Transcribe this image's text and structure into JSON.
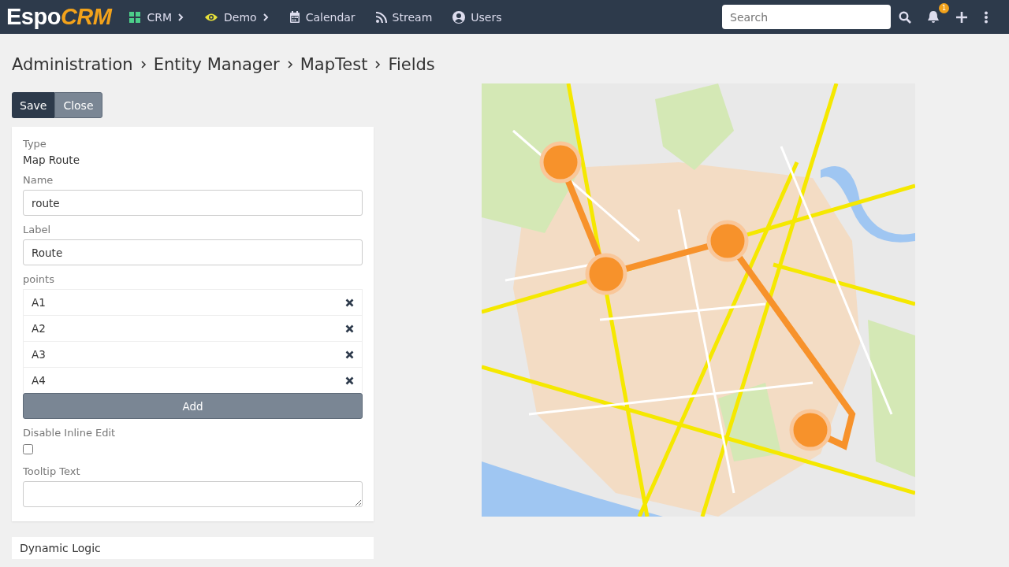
{
  "navbar": {
    "logo": {
      "first": "Espo",
      "second": "CRM"
    },
    "items": [
      {
        "kind": "grid",
        "label": "CRM",
        "dropdown": true
      },
      {
        "kind": "eye",
        "label": "Demo",
        "dropdown": true
      },
      {
        "kind": "calendar",
        "label": "Calendar",
        "dropdown": false
      },
      {
        "kind": "feed",
        "label": "Stream",
        "dropdown": false
      },
      {
        "kind": "user",
        "label": "Users",
        "dropdown": false
      }
    ],
    "search": {
      "placeholder": "Search"
    },
    "notifications": {
      "count": "1"
    }
  },
  "breadcrumb": [
    "Administration",
    "Entity Manager",
    "MapTest",
    "Fields"
  ],
  "actions": [
    {
      "label": "Save",
      "kind": "primary"
    },
    {
      "label": "Close",
      "kind": "secondary"
    }
  ],
  "form": [
    {
      "kind": "static",
      "label": "Type",
      "value": "Map Route"
    },
    {
      "kind": "input",
      "label": "Name",
      "value": "route"
    },
    {
      "kind": "input",
      "label": "Label",
      "value": "Route"
    },
    {
      "kind": "array",
      "label": "points",
      "items": [
        "A1",
        "A2",
        "A3",
        "A4"
      ],
      "button": "Add"
    },
    {
      "kind": "checkbox",
      "label": "Disable Inline Edit",
      "checked": false
    },
    {
      "kind": "textarea",
      "label": "Tooltip Text"
    }
  ],
  "panels": [
    {
      "title": "Dynamic Logic"
    }
  ],
  "map": {
    "kind": "picture"
  }
}
